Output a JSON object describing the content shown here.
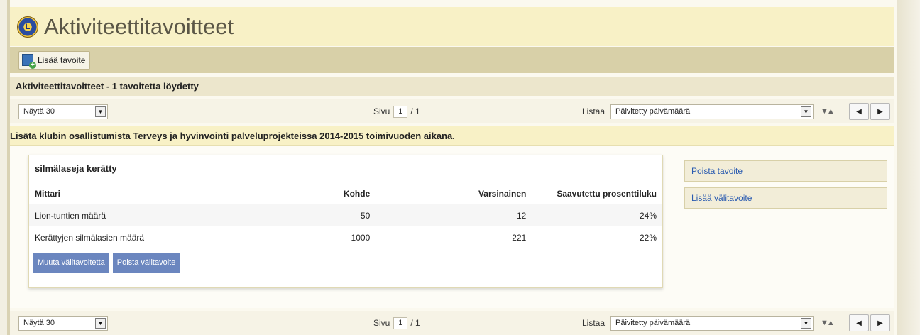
{
  "header": {
    "title": "Aktiviteettitavoitteet",
    "logo_icon": "lions-logo-icon"
  },
  "toolbar": {
    "add_label": "Lisää tavoite"
  },
  "results": {
    "summary": "Aktiviteettitavoitteet - 1 tavoitetta löydetty"
  },
  "pager": {
    "show_value": "Näytä 30",
    "page_label": "Sivu",
    "page_current": "1",
    "page_total": "/ 1",
    "sort_label": "Listaa",
    "sort_value": "Päivitetty päivämäärä",
    "sort_dir": "▼▲",
    "prev": "◀",
    "next": "▶"
  },
  "goal": {
    "title": "Lisätä klubin osallistumista Terveys ja hyvinvointi palveluprojekteissa 2014-2015 toimivuoden aikana.",
    "card_title": "silmälaseja kerätty",
    "columns": [
      "Mittari",
      "Kohde",
      "Varsinainen",
      "Saavutettu prosenttiluku"
    ],
    "rows": [
      [
        "Lion-tuntien määrä",
        "50",
        "12",
        "24%"
      ],
      [
        "Kerättyjen silmälasien määrä",
        "1000",
        "221",
        "22%"
      ]
    ],
    "edit_button": "Muuta välitavoitetta",
    "delete_sub_button": "Poista välitavoite"
  },
  "side": {
    "delete_goal": "Poista tavoite",
    "add_sub_goal": "Lisää välitavoite"
  }
}
